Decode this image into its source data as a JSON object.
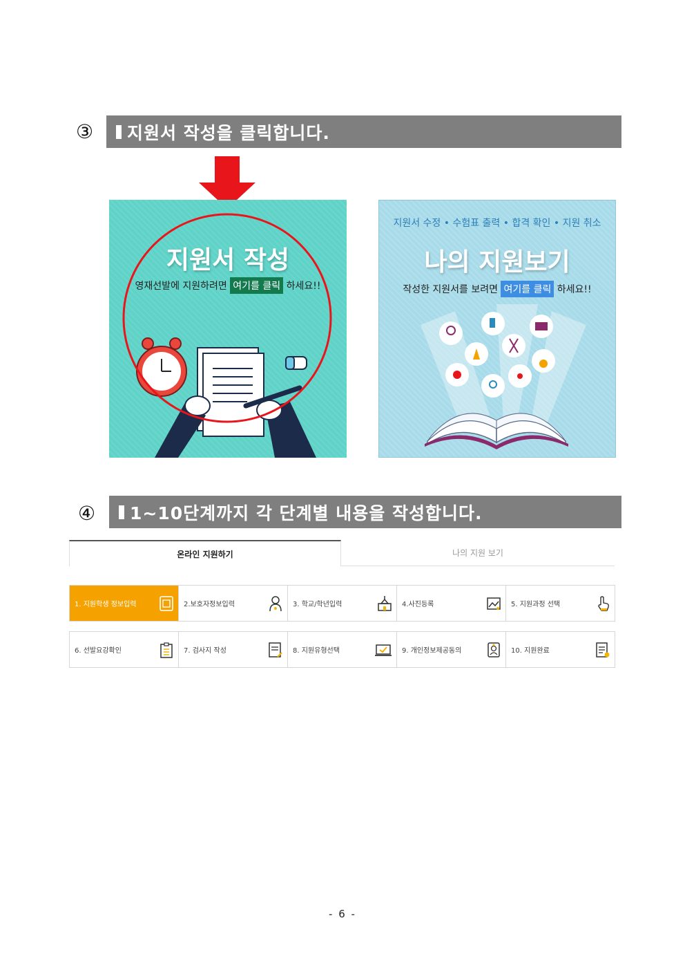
{
  "sections": {
    "step3": {
      "number": "③",
      "title": "지원서 작성을 클릭합니다."
    },
    "step4": {
      "number": "④",
      "title": "1~10단계까지 각 단계별 내용을 작성합니다."
    }
  },
  "cards": {
    "apply": {
      "title": "지원서 작성",
      "sub_before": "영재선발에 지원하려면",
      "highlight": "여기를 클릭",
      "sub_after": "하세요!!"
    },
    "view": {
      "top_line": "지원서 수정 • 수험표 출력 • 합격 확인 • 지원 취소",
      "title": "나의 지원보기",
      "sub_before": "작성한 지원서를 보려면",
      "highlight": "여기를 클릭",
      "sub_after": "하세요!!"
    }
  },
  "tabs": {
    "active": "온라인 지원하기",
    "inactive": "나의 지원 보기"
  },
  "steps_row1": [
    {
      "label": "1. 지원학생 정보입력",
      "icon": "id-card-icon"
    },
    {
      "label": "2.보호자정보입력",
      "icon": "person-icon"
    },
    {
      "label": "3. 학교/학년입력",
      "icon": "school-icon"
    },
    {
      "label": "4.사진등록",
      "icon": "photo-icon"
    },
    {
      "label": "5. 지원과정 선택",
      "icon": "hand-pointer-icon"
    }
  ],
  "steps_row2": [
    {
      "label": "6. 선발요강확인",
      "icon": "clipboard-icon"
    },
    {
      "label": "7. 검사지 작성",
      "icon": "document-edit-icon"
    },
    {
      "label": "8. 지원유형선택",
      "icon": "laptop-check-icon"
    },
    {
      "label": "9. 개인정보제공동의",
      "icon": "id-badge-icon"
    },
    {
      "label": "10. 지원완료",
      "icon": "document-done-icon"
    }
  ],
  "page_number": "- 6 -",
  "colors": {
    "bar": "#7f7f7f",
    "active_step": "#f5a100",
    "apply_card": "#5fd3c8",
    "view_card": "#a8dbe9",
    "arrow": "#e8151b"
  }
}
